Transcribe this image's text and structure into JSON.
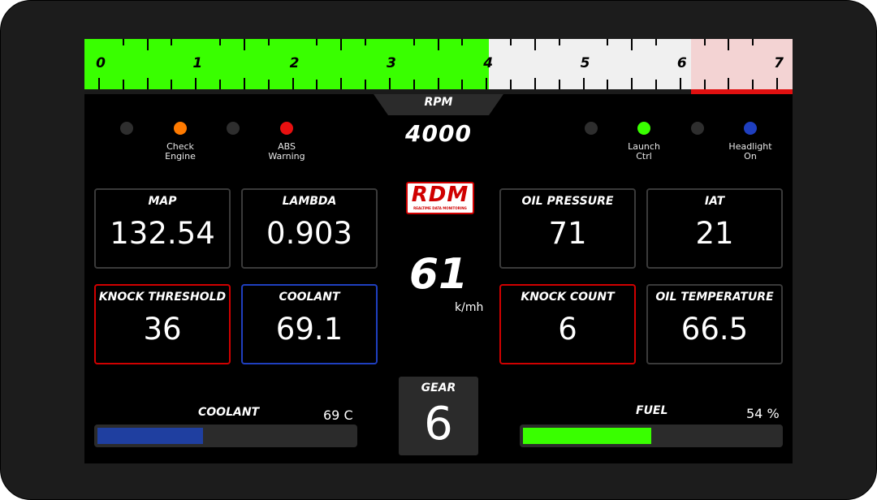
{
  "rpm": {
    "label": "RPM",
    "value": "4000",
    "scale_labels": [
      "0",
      "1",
      "2",
      "3",
      "4",
      "5",
      "6",
      "7"
    ],
    "fill_fraction": 0.571,
    "redline_start_fraction": 0.857,
    "colors": {
      "fill": "#39ff00",
      "track": "#f0f0f0",
      "redzone": "#f3d3d3",
      "redline": "#e01010"
    }
  },
  "indicators_left": [
    {
      "label": "",
      "color": "#2e2e2e"
    },
    {
      "label": "Check Engine",
      "line1": "Check",
      "line2": "Engine",
      "color": "#ff7a00"
    },
    {
      "label": "",
      "color": "#2e2e2e"
    },
    {
      "label": "ABS Warning",
      "line1": "ABS",
      "line2": "Warning",
      "color": "#e81010"
    }
  ],
  "indicators_right": [
    {
      "label": "",
      "color": "#2e2e2e"
    },
    {
      "label": "Launch Ctrl",
      "line1": "Launch",
      "line2": "Ctrl",
      "color": "#39ff00"
    },
    {
      "label": "",
      "color": "#2e2e2e"
    },
    {
      "label": "Headlight On",
      "line1": "Headlight",
      "line2": "On",
      "color": "#1f3fbf"
    }
  ],
  "boxes": [
    {
      "title": "MAP",
      "value": "132.54",
      "border": "gray"
    },
    {
      "title": "LAMBDA",
      "value": "0.903",
      "border": "gray"
    },
    {
      "title": "KNOCK THRESHOLD",
      "value": "36",
      "border": "red"
    },
    {
      "title": "COOLANT",
      "value": "69.1",
      "border": "blue"
    },
    {
      "title": "OIL PRESSURE",
      "value": "71",
      "border": "gray"
    },
    {
      "title": "IAT",
      "value": "21",
      "border": "gray"
    },
    {
      "title": "KNOCK COUNT",
      "value": "6",
      "border": "red"
    },
    {
      "title": "OIL TEMPERATURE",
      "value": "66.5",
      "border": "gray"
    }
  ],
  "logo": {
    "text": "RDM",
    "subtitle": "REALTIME DATA MONITORING"
  },
  "speed": {
    "value": "61",
    "unit": "k/mh"
  },
  "gear": {
    "label": "GEAR",
    "value": "6"
  },
  "coolant_bar": {
    "title": "COOLANT",
    "readout": "69 C",
    "fraction": 0.41,
    "color": "#1f3fa0"
  },
  "fuel_bar": {
    "title": "FUEL",
    "readout": "54 %",
    "fraction": 0.5,
    "color": "#39ff00"
  }
}
